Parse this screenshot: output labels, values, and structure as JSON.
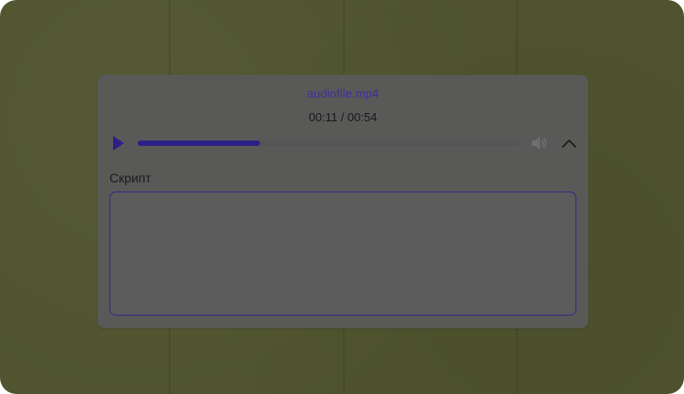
{
  "player": {
    "file_name": "audiofile.mp4",
    "time_readout": "00:11 / 00:54",
    "progress_fraction": 0.32,
    "play_icon": "play-icon",
    "volume_icon": "volume-icon",
    "collapse_icon": "chevron-up-icon"
  },
  "script_field": {
    "label": "Скрипт",
    "value": "",
    "placeholder": ""
  },
  "colors": {
    "accent": "#2c1f88",
    "file_name": "#3d2e9a",
    "panel_bg": "#595958",
    "page_bg": "#4f542e"
  }
}
